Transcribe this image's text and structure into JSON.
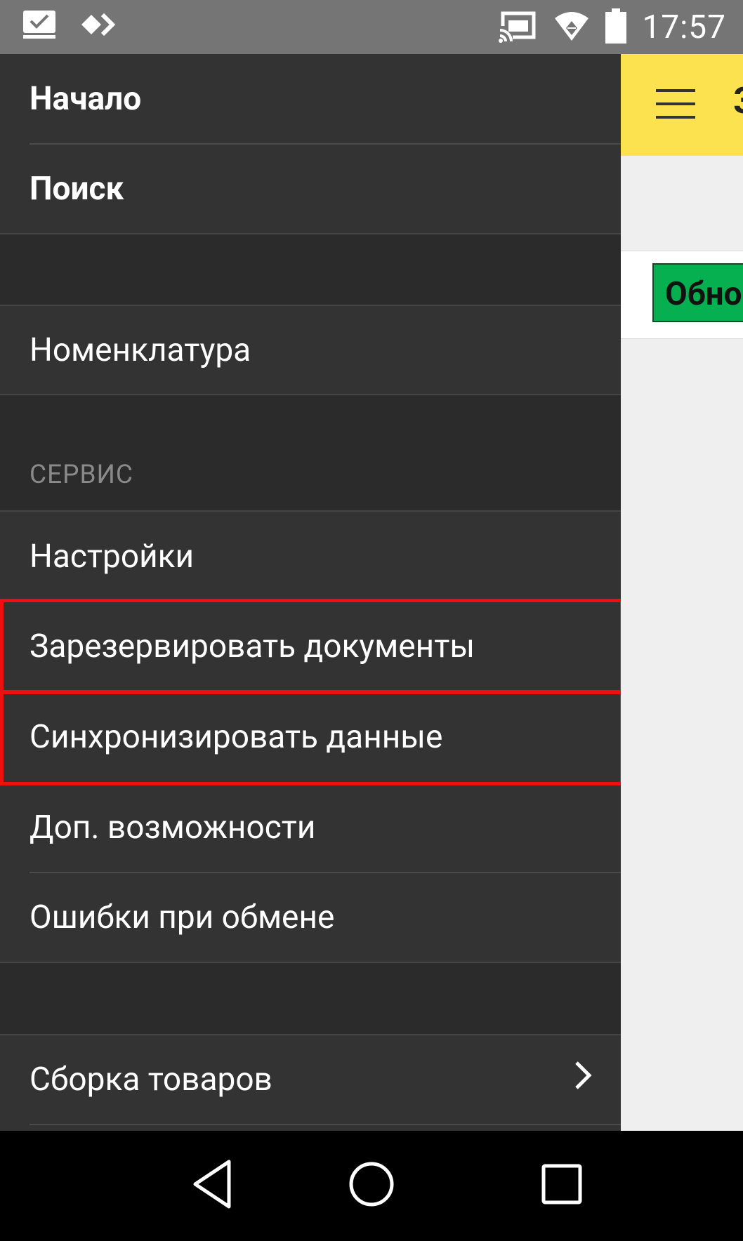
{
  "status_bar": {
    "time": "17:57",
    "icons": [
      "checklist-icon",
      "diamond-arrows-icon",
      "cast-icon",
      "wifi-icon",
      "battery-icon"
    ]
  },
  "app": {
    "title_fragment": "З",
    "refresh_button_label": "Обно"
  },
  "drawer": {
    "items": [
      {
        "label": "Начало"
      },
      {
        "label": "Поиск"
      },
      {
        "label": "Номенклатура"
      },
      {
        "section": "СЕРВИС"
      },
      {
        "label": "Настройки"
      },
      {
        "label": "Зарезервировать документы"
      },
      {
        "label": "Синхронизировать данные"
      },
      {
        "label": "Доп. возможности"
      },
      {
        "label": "Ошибки при обмене"
      },
      {
        "label": "Сборка товаров"
      }
    ]
  },
  "colors": {
    "drawer_bg": "#333333",
    "toolbar_yellow": "#fbe24e",
    "button_green": "#06b050",
    "highlight_red": "#ee0f0f"
  },
  "navbar": {
    "icons": [
      "back-icon",
      "home-icon",
      "recents-icon"
    ]
  }
}
